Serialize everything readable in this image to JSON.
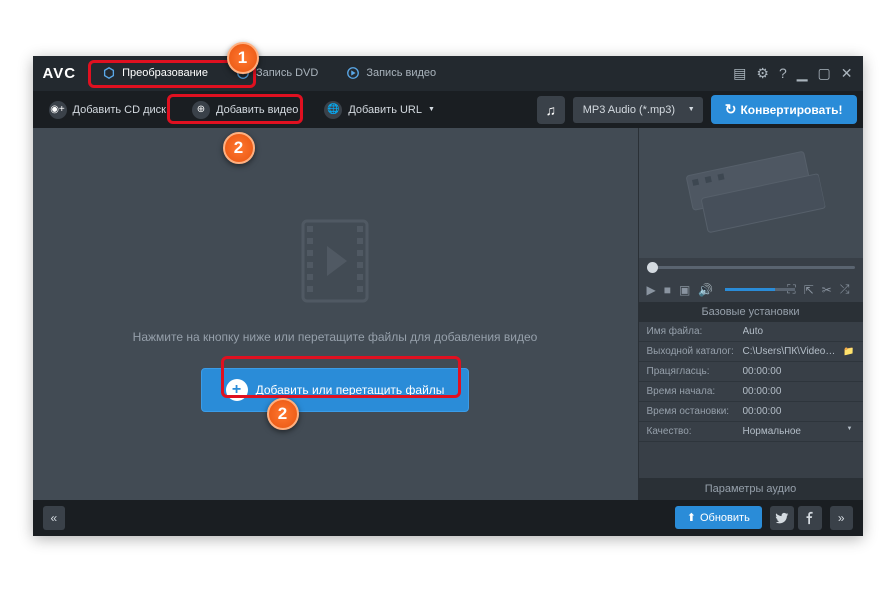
{
  "logo": "AVC",
  "tabs": [
    {
      "label": "Преобразование",
      "icon": "convert"
    },
    {
      "label": "Запись DVD",
      "icon": "dvd"
    },
    {
      "label": "Запись видео",
      "icon": "rec"
    }
  ],
  "toolbar": {
    "add_cd": "Добавить CD диск",
    "add_video": "Добавить видео",
    "add_url": "Добавить URL",
    "format": "MP3 Audio (*.mp3)",
    "convert": "Конвертировать!"
  },
  "main": {
    "hint": "Нажмите на кнопку ниже или перетащите файлы для добавления видео",
    "add_files": "Добавить или перетащить файлы"
  },
  "settings": {
    "header": "Базовые установки",
    "rows": {
      "filename_label": "Имя файла:",
      "filename_value": "Auto",
      "output_label": "Выходной каталог:",
      "output_value": "C:\\Users\\ПК\\Videos\\An...",
      "duration_label": "Працягласць:",
      "duration_value": "00:00:00",
      "start_label": "Время начала:",
      "start_value": "00:00:00",
      "stop_label": "Время остановки:",
      "stop_value": "00:00:00",
      "quality_label": "Качество:",
      "quality_value": "Нормальное"
    },
    "audio_params": "Параметры аудио"
  },
  "statusbar": {
    "update": "Обновить"
  },
  "callouts": {
    "c1": "1",
    "c2a": "2",
    "c2b": "2"
  }
}
